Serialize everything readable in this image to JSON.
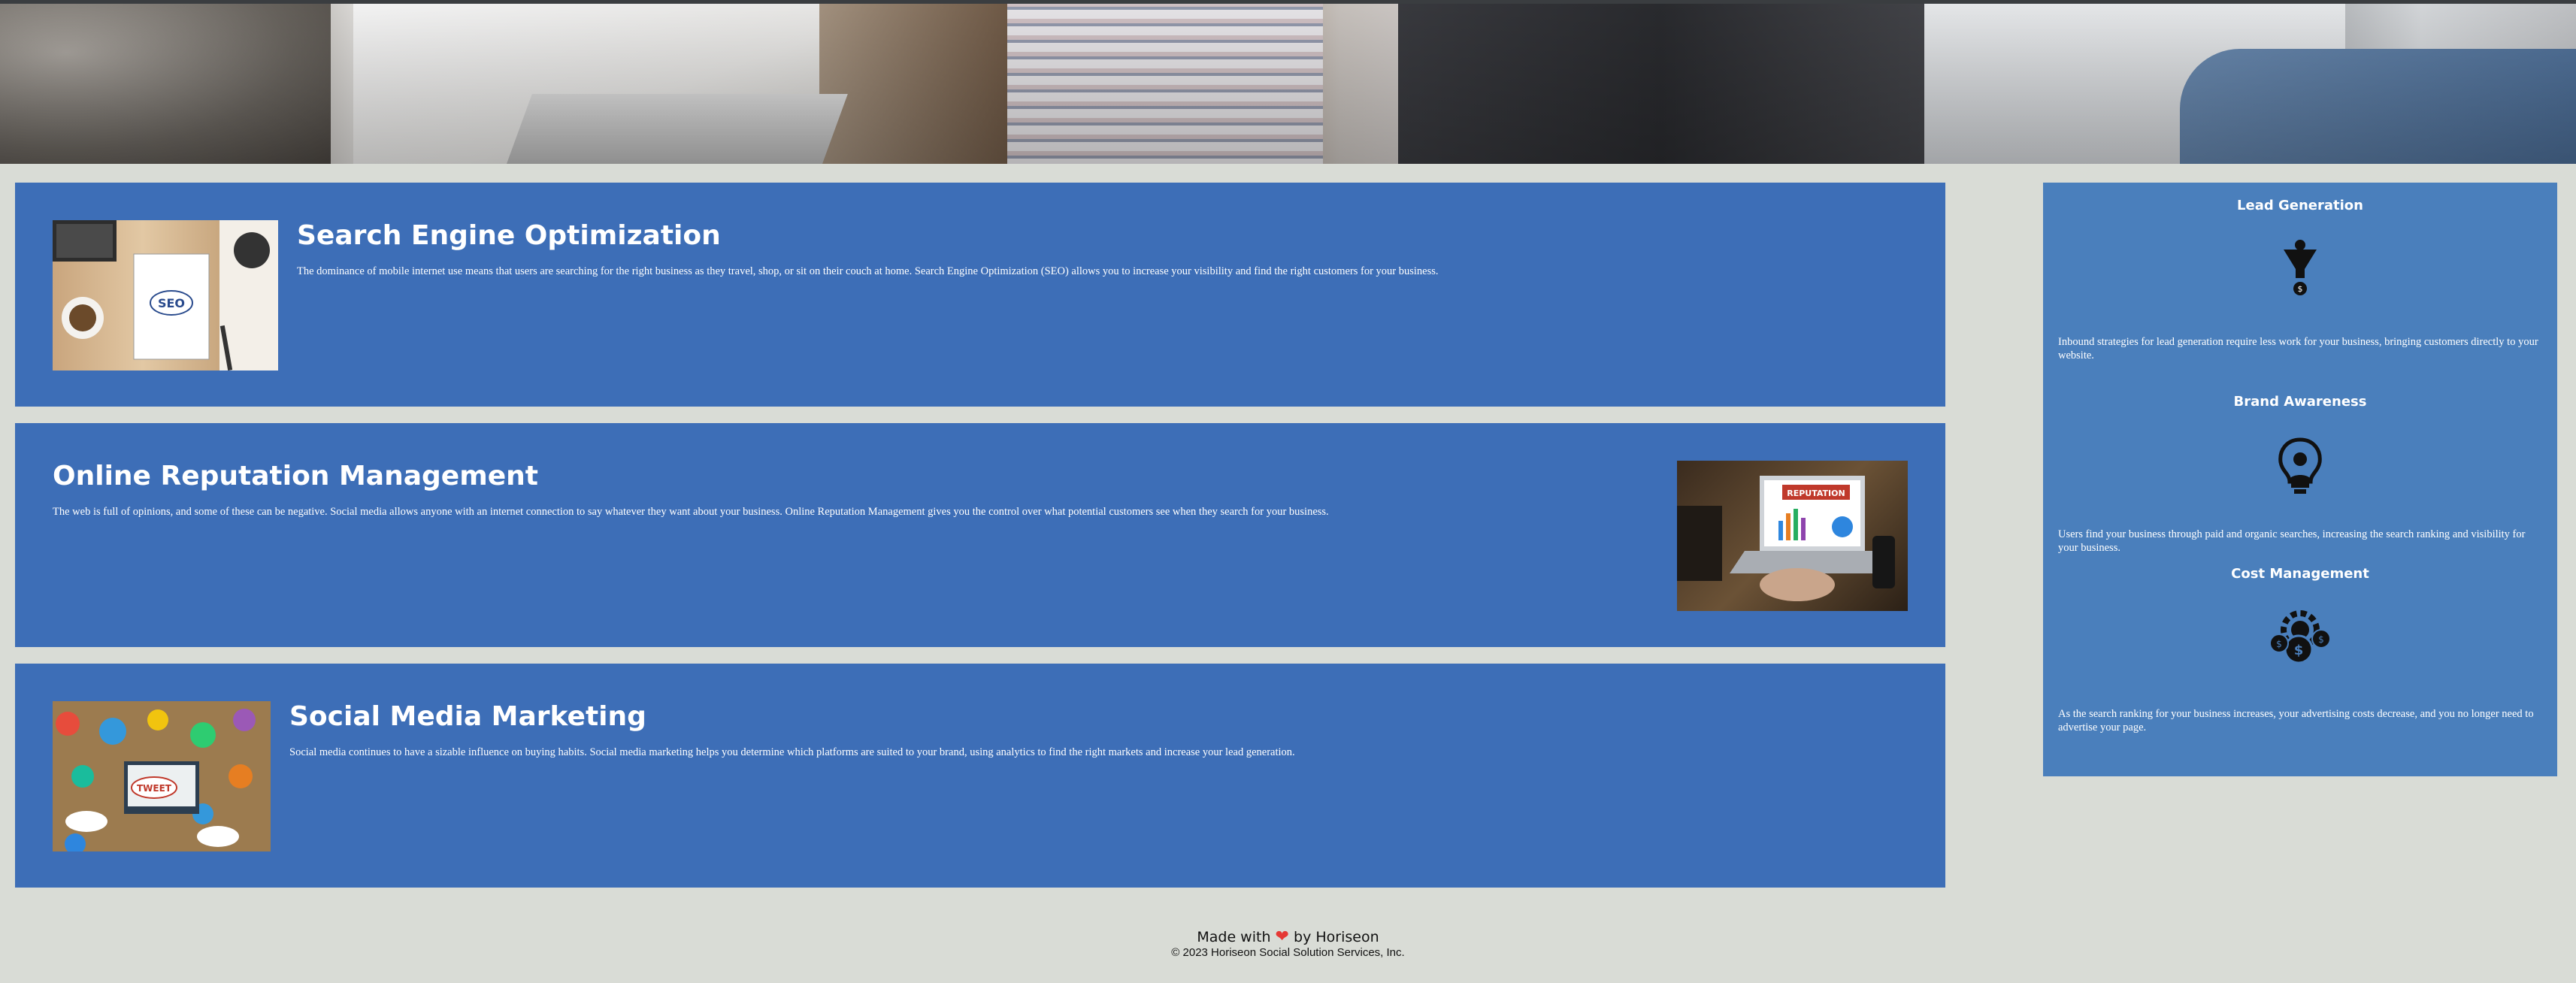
{
  "hero": {
    "image": "team-at-laptop-photo"
  },
  "services": [
    {
      "title": "Search Engine Optimization",
      "text": "The dominance of mobile internet use means that users are searching for the right business as they travel, shop, or sit on their couch at home. Search Engine Optimization (SEO) allows you to increase your visibility and find the right customers for your business.",
      "image_text": "SEO"
    },
    {
      "title": "Online Reputation Management",
      "text": "The web is full of opinions, and some of these can be negative. Social media allows anyone with an internet connection to say whatever they want about your business. Online Reputation Management gives you the control over what potential customers see when they search for your business.",
      "image_text": "REPUTATION"
    },
    {
      "title": "Social Media Marketing",
      "text": "Social media continues to have a sizable influence on buying habits. Social media marketing helps you determine which platforms are suited to your brand, using analytics to find the right markets and increase your lead generation.",
      "image_text": "TWEET"
    }
  ],
  "benefits": [
    {
      "title": "Lead Generation",
      "icon": "lead-funnel-icon",
      "text": "Inbound strategies for lead generation require less work for your business, bringing customers directly to your website."
    },
    {
      "title": "Brand Awareness",
      "icon": "lightbulb-person-icon",
      "text": "Users find your business through paid and organic searches, increasing the search ranking and visibility for your business."
    },
    {
      "title": "Cost Management",
      "icon": "gear-dollar-icon",
      "text": "As the search ranking for your business increases, your advertising costs decrease, and you no longer need to advertise your page."
    }
  ],
  "footer": {
    "made_with": "Made with",
    "by": "by Horiseon",
    "copyright": "© 2023 Horiseon Social Solution Services, Inc."
  },
  "colors": {
    "card": "#3d6eb7",
    "sidebar": "#4a7fbc",
    "background": "#d9dcd6",
    "heart": "#e53935"
  }
}
